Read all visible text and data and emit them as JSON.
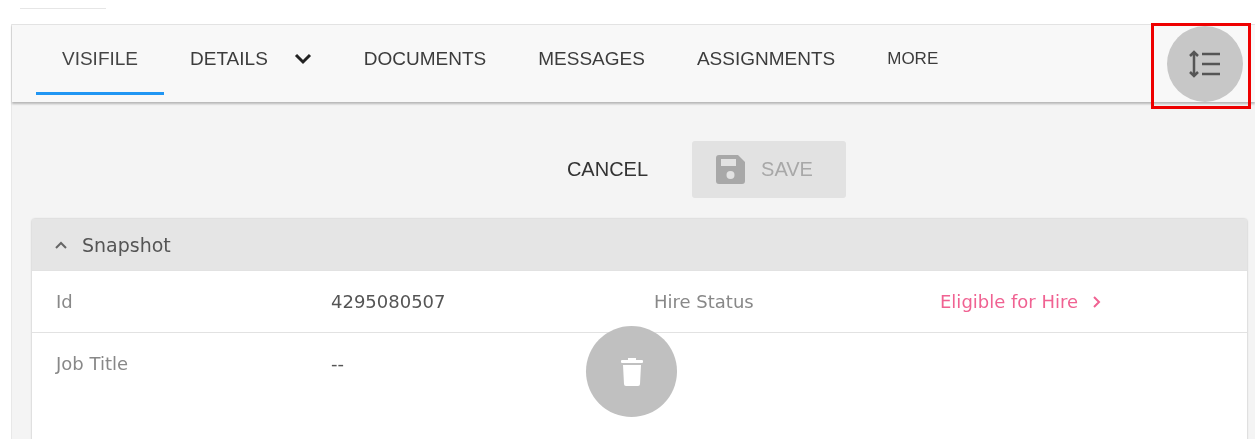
{
  "tabs": [
    {
      "label": "VISIFILE",
      "selected": true,
      "menu": false
    },
    {
      "label": "DETAILS",
      "selected": false,
      "menu": true
    },
    {
      "label": "DOCUMENTS",
      "selected": false,
      "menu": false
    },
    {
      "label": "MESSAGES",
      "selected": false,
      "menu": false
    },
    {
      "label": "ASSIGNMENTS",
      "selected": false,
      "menu": false
    },
    {
      "label": "MORE",
      "selected": false,
      "menu": false
    }
  ],
  "toolbar_button": {
    "highlighted": true
  },
  "actions": {
    "cancel": "CANCEL",
    "save": {
      "label": "SAVE",
      "disabled": true
    }
  },
  "snapshot": {
    "title": "Snapshot",
    "expanded": true,
    "rows": [
      {
        "fields": [
          {
            "label": "Id",
            "value": "4295080507",
            "kind": "text"
          },
          {
            "label": "Hire Status",
            "value": "Eligible for Hire",
            "kind": "link"
          }
        ]
      },
      {
        "fields": [
          {
            "label": "Job Title",
            "value": "--",
            "kind": "text"
          }
        ]
      }
    ]
  }
}
